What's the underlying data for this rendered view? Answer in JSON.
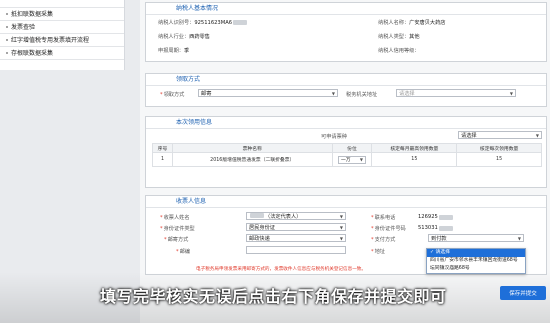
{
  "sidebar": {
    "items": [
      {
        "label": "",
        "top": true
      },
      {
        "label": "抵扣联数据采集"
      },
      {
        "label": "发票查验"
      },
      {
        "label": "红字增值税专用发票填开流程"
      },
      {
        "label": "存根联数据采集"
      }
    ]
  },
  "taxpayer": {
    "title": "纳税人基本情况",
    "id_label": "纳税人识别号：",
    "id_value": "92511623MA6",
    "name_label": "纳税人名称：",
    "name_value": "广安唐贝大药店",
    "industry_label": "纳税人行业：",
    "industry_value": "西药零售",
    "type_label": "纳税人类型：",
    "type_value": "其他",
    "period_label": "申报周期：",
    "period_value": "季",
    "credit_label": "纳税人信用等级："
  },
  "method": {
    "title": "领取方式",
    "method_label": "领取方式",
    "method_value": "邮寄",
    "office_label": "税务机关地址",
    "office_placeholder": "请选择"
  },
  "claim": {
    "title": "本次领用信息",
    "type_header": "可申请票种",
    "select_label": "请选择",
    "columns": [
      "序号",
      "票种名称",
      "份位",
      "核定每月最高领用数量",
      "核定每次领用数量"
    ],
    "rows": [
      {
        "no": "1",
        "name": "2016版增值税普通发票（二联折叠票）",
        "unit": "一万",
        "monthly": "15",
        "each": "15"
      }
    ]
  },
  "receiver": {
    "title": "收票人信息",
    "name_label": "收票人姓名",
    "name_value": "（法定代表人）",
    "phone_label": "联系电话",
    "phone_value": "126925",
    "id_type_label": "身份证件类型",
    "id_type_value": "居民身份证",
    "id_no_label": "身份证件号码",
    "id_no_value": "513031",
    "delivery_label": "邮寄方式",
    "delivery_value": "邮政快递",
    "pay_label": "支付方式",
    "pay_value": "到付款",
    "postcode_label": "邮编",
    "address_label": "地址",
    "address_options": [
      "请选择",
      "四川省广安市邻水县丰禾镇回龙街道68号",
      "坛同镇汉庙路68号"
    ],
    "note": "电子税务局申领发票采用邮寄方式的，发票收件人信息应与税务机关登记信息一致。"
  },
  "caption": "填写完毕核实无误后点击右下角保存并提交即可",
  "submit_label": "保存并提交"
}
